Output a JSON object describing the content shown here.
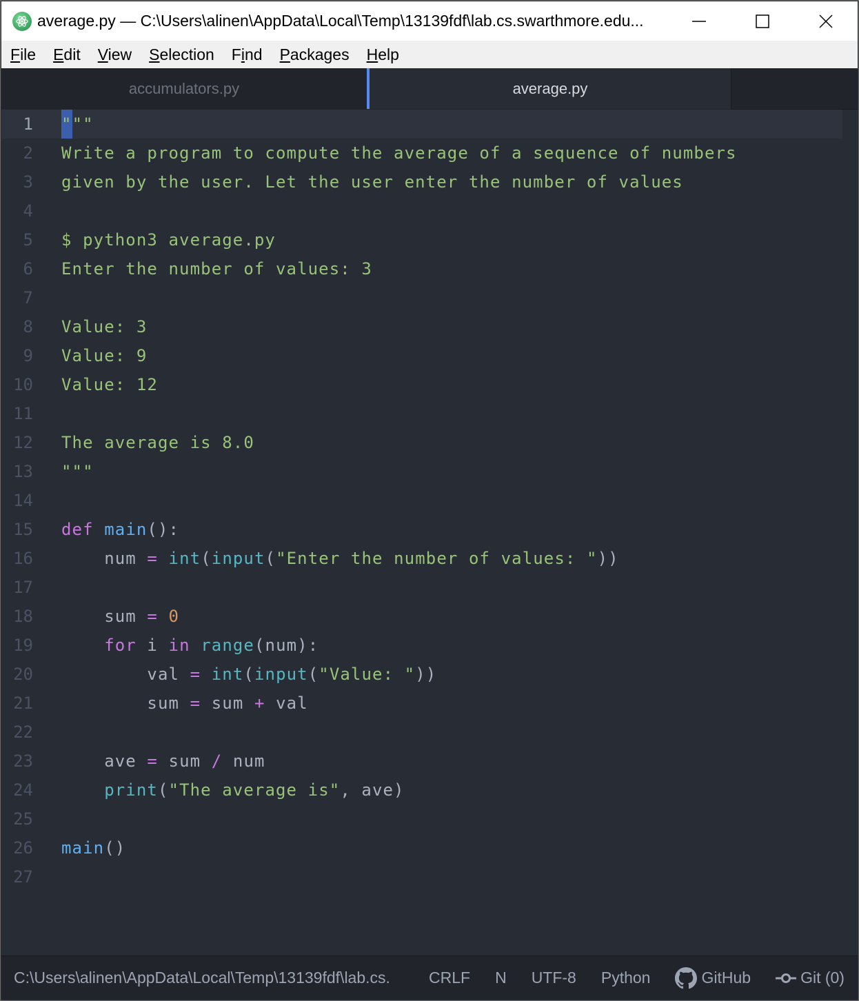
{
  "window": {
    "title": "average.py — C:\\Users\\alinen\\AppData\\Local\\Temp\\13139fdf\\lab.cs.swarthmore.edu...",
    "controls": {
      "minimize": "minimize",
      "maximize": "maximize",
      "close": "close"
    }
  },
  "menu": {
    "items": [
      {
        "label_u": "F",
        "label_rest": "ile"
      },
      {
        "label_u": "E",
        "label_rest": "dit"
      },
      {
        "label_u": "V",
        "label_rest": "iew"
      },
      {
        "label_u": "S",
        "label_rest": "election"
      },
      {
        "label_pre": "F",
        "label_u": "i",
        "label_rest": "nd"
      },
      {
        "label_u": "P",
        "label_rest": "ackages"
      },
      {
        "label_u": "H",
        "label_rest": "elp"
      }
    ]
  },
  "tabs": [
    {
      "label": "accumulators.py",
      "active": false
    },
    {
      "label": "average.py",
      "active": true
    }
  ],
  "editor": {
    "cursor_line": 1,
    "lines": [
      {
        "n": "1"
      },
      {
        "n": "2"
      },
      {
        "n": "3"
      },
      {
        "n": "4"
      },
      {
        "n": "5"
      },
      {
        "n": "6"
      },
      {
        "n": "7"
      },
      {
        "n": "8"
      },
      {
        "n": "9"
      },
      {
        "n": "10"
      },
      {
        "n": "11"
      },
      {
        "n": "12"
      },
      {
        "n": "13"
      },
      {
        "n": "14"
      },
      {
        "n": "15"
      },
      {
        "n": "16"
      },
      {
        "n": "17"
      },
      {
        "n": "18"
      },
      {
        "n": "19"
      },
      {
        "n": "20"
      },
      {
        "n": "21"
      },
      {
        "n": "22"
      },
      {
        "n": "23"
      },
      {
        "n": "24"
      },
      {
        "n": "25"
      },
      {
        "n": "26"
      },
      {
        "n": "27"
      }
    ],
    "code": {
      "l1_a": "\"",
      "l1_b": "\"\"",
      "l2": "Write a program to compute the average of a sequence of numbers",
      "l3": "given by the user. Let the user enter the number of values",
      "l5": "$ python3 average.py",
      "l6": "Enter the number of values: 3",
      "l8": "Value: 3",
      "l9": "Value: 9",
      "l10": "Value: 12",
      "l12": "The average is 8.0",
      "l13": "\"\"\"",
      "l15_def": "def",
      "l15_main": "main",
      "l15_rest": "():",
      "l16_var": "num",
      "l16_eq": "=",
      "l16_int": "int",
      "l16_p1": "(",
      "l16_input": "input",
      "l16_p2": "(",
      "l16_str": "\"Enter the number of values: \"",
      "l16_p3": "))",
      "l18_var": "sum",
      "l18_eq": "=",
      "l18_num": "0",
      "l19_for": "for",
      "l19_i": "i",
      "l19_in": "in",
      "l19_range": "range",
      "l19_rest": "(num):",
      "l20_var": "val",
      "l20_eq": "=",
      "l20_int": "int",
      "l20_p1": "(",
      "l20_input": "input",
      "l20_p2": "(",
      "l20_str": "\"Value: \"",
      "l20_p3": "))",
      "l21_var": "sum",
      "l21_eq": "=",
      "l21_a": "sum",
      "l21_op": "+",
      "l21_b": "val",
      "l23_var": "ave",
      "l23_eq": "=",
      "l23_a": "sum",
      "l23_op": "/",
      "l23_b": "num",
      "l24_print": "print",
      "l24_p1": "(",
      "l24_str": "\"The average is\"",
      "l24_rest": ", ave)",
      "l26_main": "main",
      "l26_rest": "()"
    }
  },
  "statusbar": {
    "path": "C:\\Users\\alinen\\AppData\\Local\\Temp\\13139fdf\\lab.cs.",
    "line_ending": "CRLF",
    "indicator": "N",
    "encoding": "UTF-8",
    "grammar": "Python",
    "github": "GitHub",
    "git": "Git (0)"
  },
  "colors": {
    "accent": "#568af2",
    "string": "#98c379",
    "keyword": "#c678dd",
    "function": "#61afef",
    "builtin": "#56b6c2",
    "number": "#d19a66"
  }
}
